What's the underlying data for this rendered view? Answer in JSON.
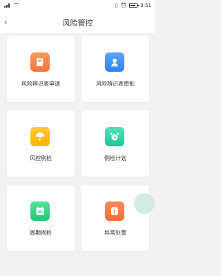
{
  "status_bar": {
    "time": "9:51",
    "battery_level": 0.7
  },
  "nav": {
    "title": "风险管控",
    "back_icon": "chevron-left-icon"
  },
  "items": [
    {
      "label": "风险辨识表申请",
      "icon": "edit-document-icon",
      "color": "#ff7b3a"
    },
    {
      "label": "风险辨识表审批",
      "icon": "approval-user-icon",
      "color": "#2f80ff"
    },
    {
      "label": "风控例检",
      "icon": "umbrella-icon",
      "color": "#ffb300"
    },
    {
      "label": "例检计划",
      "icon": "alarm-clock-icon",
      "color": "#1ac89a"
    },
    {
      "label": "周期例检",
      "icon": "calendar-icon",
      "color": "#20c67a"
    },
    {
      "label": "异常处置",
      "icon": "alert-card-icon",
      "color": "#ff6a35"
    }
  ]
}
